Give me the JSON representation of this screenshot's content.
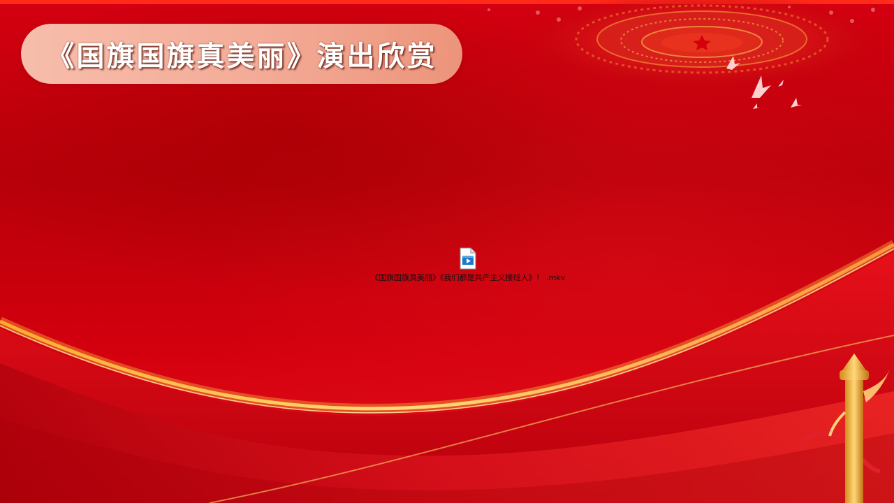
{
  "slide": {
    "title": "《国旗国旗真美丽》演出欣赏"
  },
  "media": {
    "icon": "video-file-icon",
    "filename": "《国旗国旗真美丽》《我们都是共产主义接班人》！ .mkv"
  },
  "colors": {
    "background": "#c8000a",
    "title_pill": "#f6b49e",
    "title_text": "#ffffff",
    "gold_wave": "#ffd23a"
  }
}
